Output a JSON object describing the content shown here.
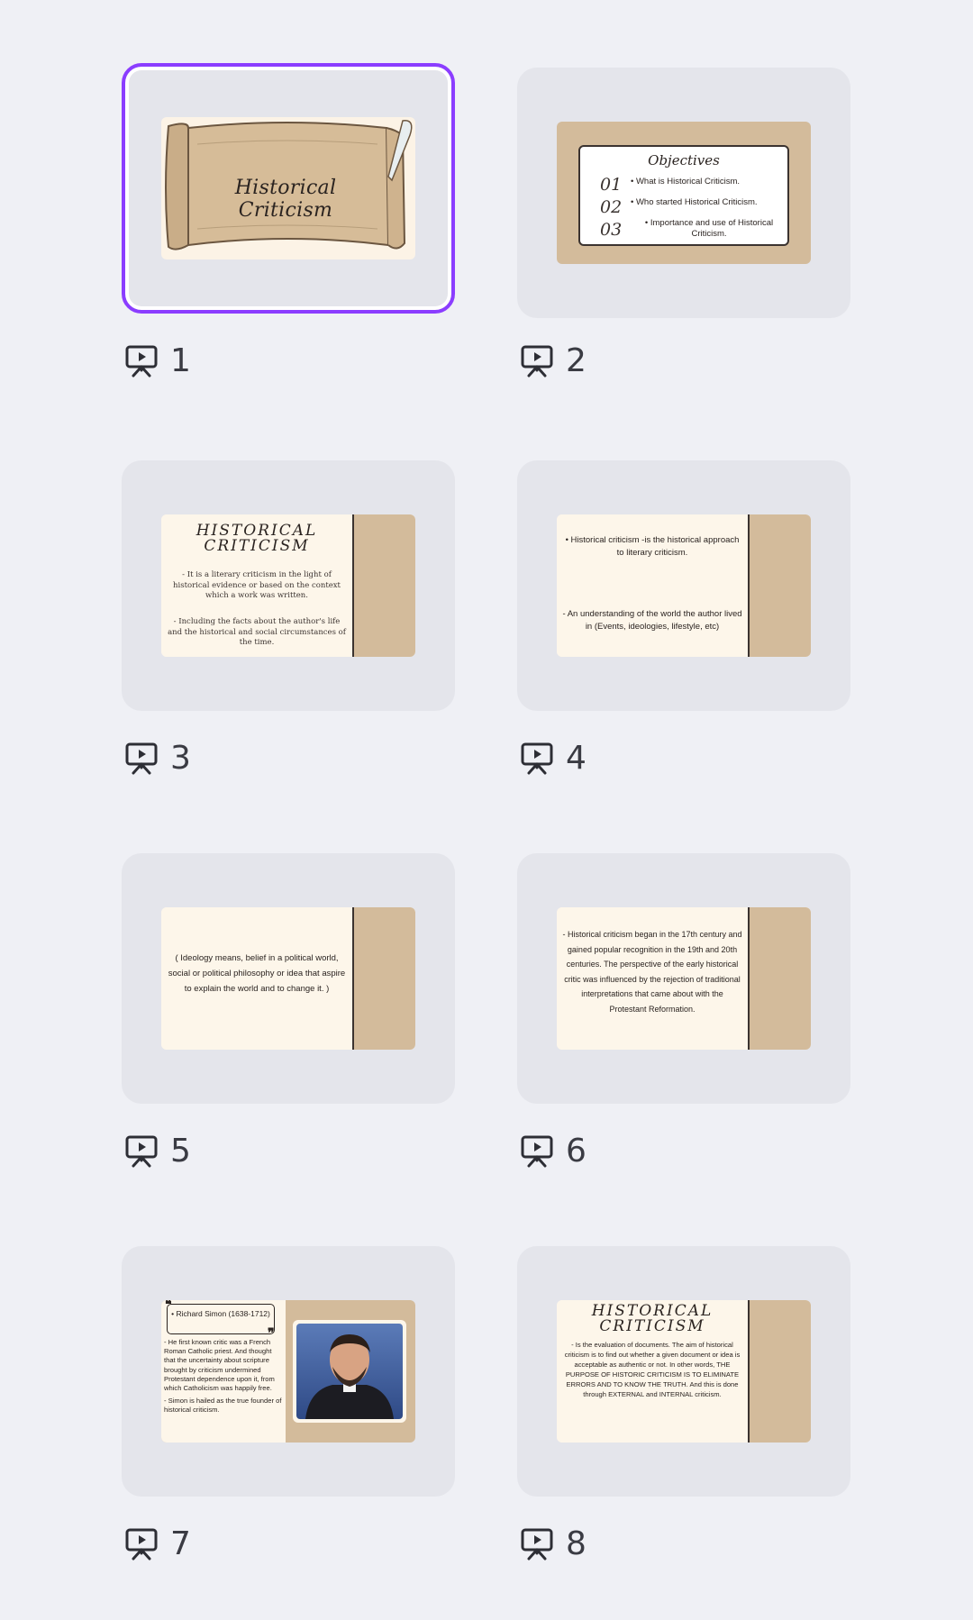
{
  "slides": [
    {
      "number": "1",
      "selected": true,
      "title": "Historical Criticism"
    },
    {
      "number": "2",
      "title": "Objectives",
      "nums": [
        "01",
        "02",
        "03"
      ],
      "items": [
        "• What is Historical Criticism.",
        "• Who started Historical Criticism.",
        "• Importance and use of Historical Criticism."
      ]
    },
    {
      "number": "3",
      "title": "HISTORICAL CRITICISM",
      "para1": "- It is a literary criticism in the light of historical evidence or based on the context which a work was written.",
      "para2": "- Including the facts about the author's life and the historical and social circumstances of the time."
    },
    {
      "number": "4",
      "para1": "• Historical criticism -is the historical approach to literary criticism.",
      "para2": "- An understanding of the world the author lived in (Events, ideologies, lifestyle, etc)"
    },
    {
      "number": "5",
      "para1": "( Ideology means, belief in a political world, social or political philosophy or idea that aspire to explain the world and to change it. )"
    },
    {
      "number": "6",
      "para1": "- Historical criticism began in the 17th century and gained popular recognition in the 19th and 20th centuries. The perspective of the early historical critic was influenced by the rejection of traditional interpretations that came about with the Protestant Reformation."
    },
    {
      "number": "7",
      "name": "• Richard Simon (1638-1712)",
      "para1": "- He first known critic was a French Roman Catholic priest. And thought that the uncertainty about scripture brought by criticism undermined Protestant dependence upon it, from which Catholicism was happily free.",
      "para2": "- Simon is hailed as the true founder of historical criticism."
    },
    {
      "number": "8",
      "title": "HISTORICAL CRITICISM",
      "para1": "- Is the evaluation of documents. The aim of historical criticism is to find out whether a given document or idea is acceptable as authentic or not. In other words, THE PURPOSE OF HISTORIC CRITICISM IS TO ELIMINATE ERRORS AND TO KNOW THE TRUTH. And this is done through EXTERNAL and INTERNAL criticism."
    }
  ],
  "icons": {
    "slide_type": "presentation-icon"
  },
  "colors": {
    "selection": "#8b3dff",
    "tan": "#d3bb9b",
    "cream": "#fdf6ea",
    "background": "#eff0f5"
  }
}
